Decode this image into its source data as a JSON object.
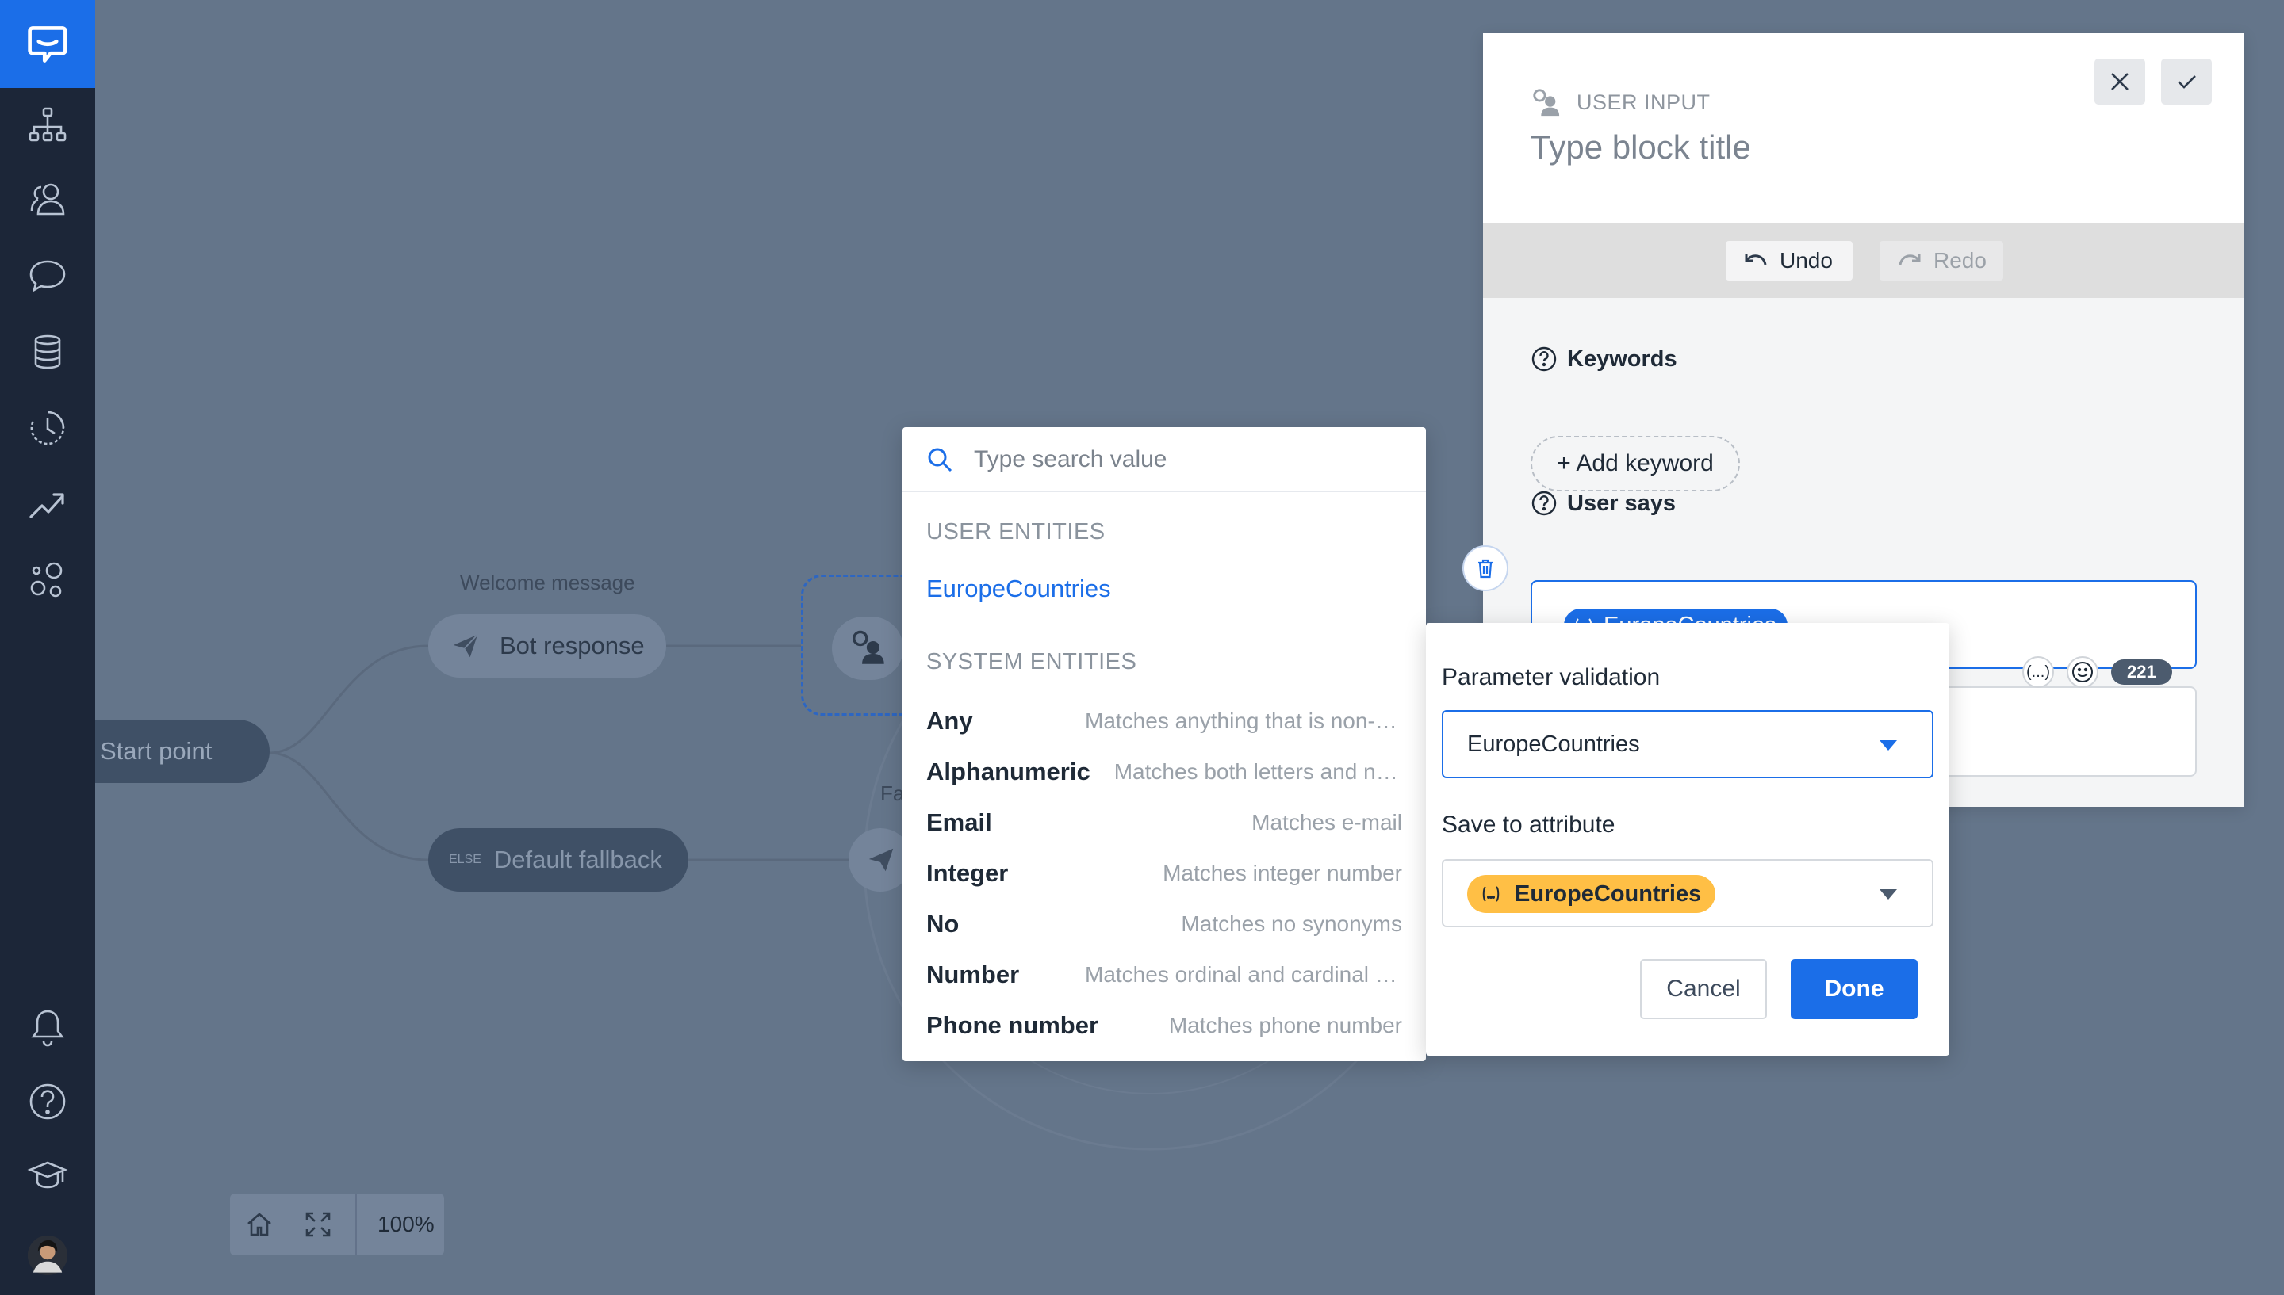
{
  "theme": {
    "accent": "#1b6ee8",
    "sidebar_bg": "#1c2638",
    "canvas_bg": "#64758a",
    "attribute_chip": "#ffbf45"
  },
  "sidebar": {
    "logo_icon": "chat-logo-icon",
    "items": [
      {
        "icon": "stories-icon"
      },
      {
        "icon": "audience-icon"
      },
      {
        "icon": "chat-bubble-icon"
      },
      {
        "icon": "database-icon"
      },
      {
        "icon": "history-icon"
      },
      {
        "icon": "analytics-icon"
      },
      {
        "icon": "integrations-icon"
      }
    ],
    "bottom_items": [
      {
        "icon": "bell-icon"
      },
      {
        "icon": "help-icon"
      },
      {
        "icon": "academy-icon"
      },
      {
        "icon": "avatar"
      }
    ]
  },
  "canvas": {
    "start_label": "Start point",
    "welcome_label": "Welcome message",
    "bot_response_label": "Bot response",
    "else_tag": "ELSE",
    "fallback_label": "Default fallback",
    "partial_label": "Fa",
    "zoom_level": "100%"
  },
  "block_panel": {
    "type_label": "USER INPUT",
    "title_placeholder": "Type block title",
    "undo_label": "Undo",
    "redo_label": "Redo",
    "keywords_label": "Keywords",
    "add_keyword_label": "+ Add keyword",
    "user_says_label": "User says",
    "user_says_entity": "EuropeCountries",
    "char_count": "221",
    "variable_tool": "(...)"
  },
  "entity_dropdown": {
    "search_placeholder": "Type search value",
    "user_entities_header": "USER ENTITIES",
    "user_entities": [
      "EuropeCountries"
    ],
    "system_entities_header": "SYSTEM ENTITIES",
    "system_entities": [
      {
        "name": "Any",
        "desc": "Matches anything that is non-empty"
      },
      {
        "name": "Alphanumeric",
        "desc": "Matches both letters and numbers"
      },
      {
        "name": "Email",
        "desc": "Matches e-mail"
      },
      {
        "name": "Integer",
        "desc": "Matches integer number"
      },
      {
        "name": "No",
        "desc": "Matches no synonyms"
      },
      {
        "name": "Number",
        "desc": "Matches ordinal and cardinal numbers"
      },
      {
        "name": "Phone number",
        "desc": "Matches phone number"
      }
    ]
  },
  "param_popup": {
    "validation_label": "Parameter validation",
    "validation_value": "EuropeCountries",
    "attribute_label": "Save to attribute",
    "attribute_value": "EuropeCountries",
    "cancel_label": "Cancel",
    "done_label": "Done"
  }
}
